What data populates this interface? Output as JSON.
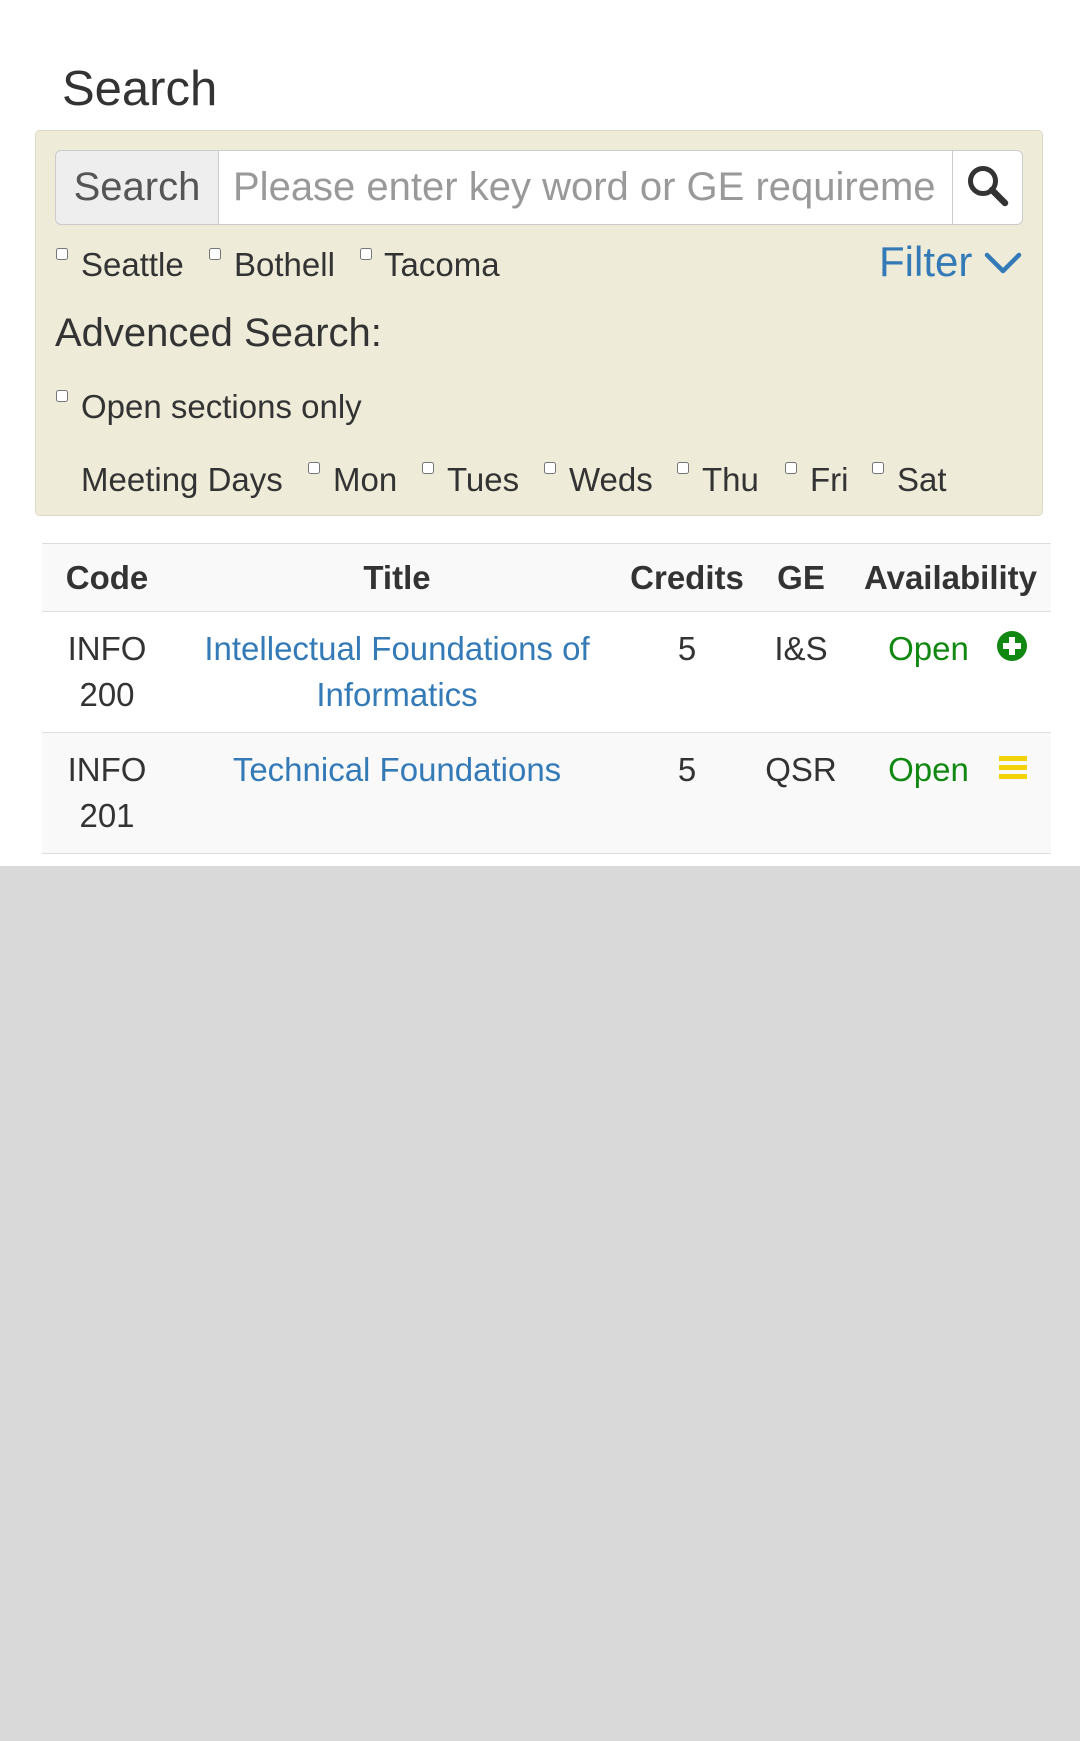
{
  "page": {
    "title": "Search"
  },
  "search": {
    "addon_label": "Search",
    "placeholder": "Please enter key word or GE requirement",
    "value": ""
  },
  "campuses": [
    {
      "label": "Seattle",
      "checked": false
    },
    {
      "label": "Bothell",
      "checked": false
    },
    {
      "label": "Tacoma",
      "checked": false
    }
  ],
  "filter": {
    "label": "Filter",
    "icon": "chevron-down-icon"
  },
  "advanced": {
    "title": "Advenced Search:",
    "open_only_label": "Open sections only",
    "meeting_days_label": "Meeting Days",
    "days": [
      "Mon",
      "Tues",
      "Weds",
      "Thu",
      "Fri",
      "Sat"
    ]
  },
  "table": {
    "headers": [
      "Code",
      "Title",
      "Credits",
      "GE",
      "Availability"
    ],
    "rows": [
      {
        "code_line1": "INFO",
        "code_line2": "200",
        "title": "Intellectual Foundations of Informatics",
        "credits": "5",
        "ge": "I&S",
        "availability": "Open",
        "icon": "plus-circle-icon",
        "icon_color": "#118811"
      },
      {
        "code_line1": "INFO",
        "code_line2": "201",
        "title": "Technical Foundations",
        "credits": "5",
        "ge": "QSR",
        "availability": "Open",
        "icon": "menu-icon",
        "icon_color": "#f2d30a"
      }
    ]
  },
  "colors": {
    "panel_bg": "#efebd9",
    "link": "#337ab7",
    "open": "#118811",
    "page_bg": "#d9d9d9"
  }
}
